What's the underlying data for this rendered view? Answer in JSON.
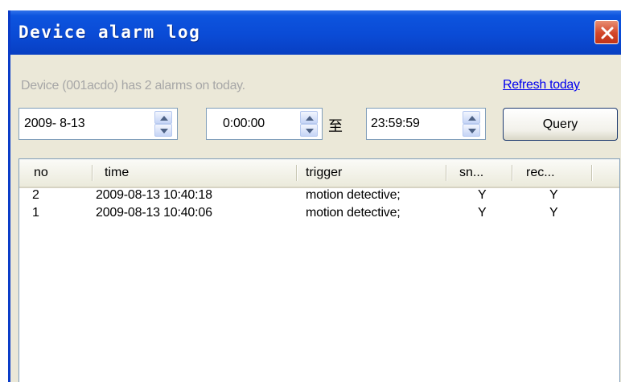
{
  "window": {
    "title": "Device alarm log",
    "close_icon": "close-x-icon"
  },
  "status_text": "Device (001acdo) has 2 alarms on today.",
  "refresh_link": "Refresh today",
  "date_field": {
    "value": "2009- 8-13"
  },
  "start_time_field": {
    "value": "0:00:00"
  },
  "range_separator": "至",
  "end_time_field": {
    "value": "23:59:59"
  },
  "query_button": "Query",
  "table": {
    "columns": [
      "no",
      "time",
      "trigger",
      "sn...",
      "rec..."
    ],
    "rows": [
      {
        "no": "2",
        "time": "2009-08-13 10:40:18",
        "trigger": "motion detective;",
        "snapshot": "Y",
        "record": "Y"
      },
      {
        "no": "1",
        "time": "2009-08-13 10:40:06",
        "trigger": "motion detective;",
        "snapshot": "Y",
        "record": "Y"
      }
    ]
  },
  "colors": {
    "titlebar": "#0a4bd6",
    "close_button": "#d2462a",
    "dialog_bg": "#ebe8d8",
    "link": "#0000ee",
    "disabled_text": "#a7a7a7"
  }
}
